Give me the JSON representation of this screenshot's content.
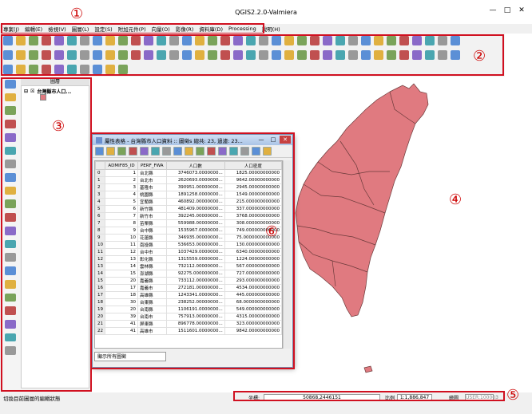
{
  "window": {
    "title": "QGIS2.2.0-Valmiera",
    "min": "—",
    "max": "□",
    "close": "✕"
  },
  "annotations": {
    "n1": "①",
    "n2": "②",
    "n3": "③",
    "n4": "④",
    "n5": "⑤",
    "n6": "⑥"
  },
  "menu": [
    "專案(J)",
    "編輯(E)",
    "檢視(V)",
    "圖層(L)",
    "設定(S)",
    "附加元件(P)",
    "向量(O)",
    "影像(R)",
    "資料庫(D)",
    "Processing",
    "說明(H)"
  ],
  "legend": {
    "header": "圖層",
    "layer_name": "台灣縣市人口..."
  },
  "status": {
    "message": "切換目前圖層的編輯狀態",
    "coord_label": "坐標:",
    "coord_value": "50868,2446151",
    "scale_label": "比例",
    "scale_value": "1:1,886,847",
    "render_label": "繪圖",
    "epsg": "USER:100003"
  },
  "attribute_table": {
    "title": "屬性表格 - 台灣縣市人口資料 :: 圖徵s 總共: 23, 過濾: 23...",
    "columns": [
      "ADMIF85_ID",
      "PERF_FWA",
      "人口數",
      "人口密度"
    ],
    "rows": [
      [
        "0",
        "1",
        "台北縣",
        "3746073.0000000...",
        "1825.00000000000"
      ],
      [
        "1",
        "2",
        "台北市",
        "2620693.0000000...",
        "9642.00000000000"
      ],
      [
        "2",
        "3",
        "基隆市",
        "390951.00000000...",
        "2945.00000000000"
      ],
      [
        "3",
        "4",
        "桃園縣",
        "1891258.0000000...",
        "1549.00000000000"
      ],
      [
        "4",
        "5",
        "宜蘭縣",
        "460892.00000000...",
        "215.000000000000"
      ],
      [
        "5",
        "6",
        "新竹縣",
        "481409.00000000...",
        "337.000000000000"
      ],
      [
        "6",
        "7",
        "新竹市",
        "392245.00000000...",
        "3768.00000000000"
      ],
      [
        "7",
        "8",
        "苗栗縣",
        "559988.00000000...",
        "308.000000000000"
      ],
      [
        "8",
        "9",
        "台中縣",
        "1535967.0000000...",
        "749.000000000000"
      ],
      [
        "9",
        "10",
        "花蓮縣",
        "346935.00000000...",
        "75.0000000000000"
      ],
      [
        "10",
        "11",
        "南投縣",
        "536653.00000000...",
        "130.000000000000"
      ],
      [
        "11",
        "12",
        "台中市",
        "1037429.0000000...",
        "6340.00000000000"
      ],
      [
        "12",
        "13",
        "彰化縣",
        "1315559.0000000...",
        "1224.00000000000"
      ],
      [
        "13",
        "14",
        "雲林縣",
        "732112.00000000...",
        "567.000000000000"
      ],
      [
        "14",
        "15",
        "澎湖縣",
        "92275.000000000...",
        "727.000000000000"
      ],
      [
        "15",
        "20",
        "嘉義縣",
        "733112.00000000...",
        "293.000000000000"
      ],
      [
        "16",
        "17",
        "嘉義市",
        "272181.00000000...",
        "4534.00000000000"
      ],
      [
        "17",
        "18",
        "高雄縣",
        "1243341.0000000...",
        "445.000000000000"
      ],
      [
        "18",
        "30",
        "台東縣",
        "238252.00000000...",
        "68.0000000000000"
      ],
      [
        "19",
        "20",
        "台南縣",
        "1106191.0000000...",
        "549.000000000000"
      ],
      [
        "20",
        "39",
        "台南市",
        "757913.00000000...",
        "4315.00000000000"
      ],
      [
        "21",
        "41",
        "屏東縣",
        "896778.00000000...",
        "323.000000000000"
      ],
      [
        "22",
        "41",
        "高雄市",
        "1511601.0000000...",
        "9842.00000000000"
      ]
    ],
    "show_all": "顯示所有圖徵"
  },
  "colors": {
    "map_fill": "#e07a80",
    "map_stroke": "#6b3a3a",
    "annotation_red": "#d01020"
  }
}
